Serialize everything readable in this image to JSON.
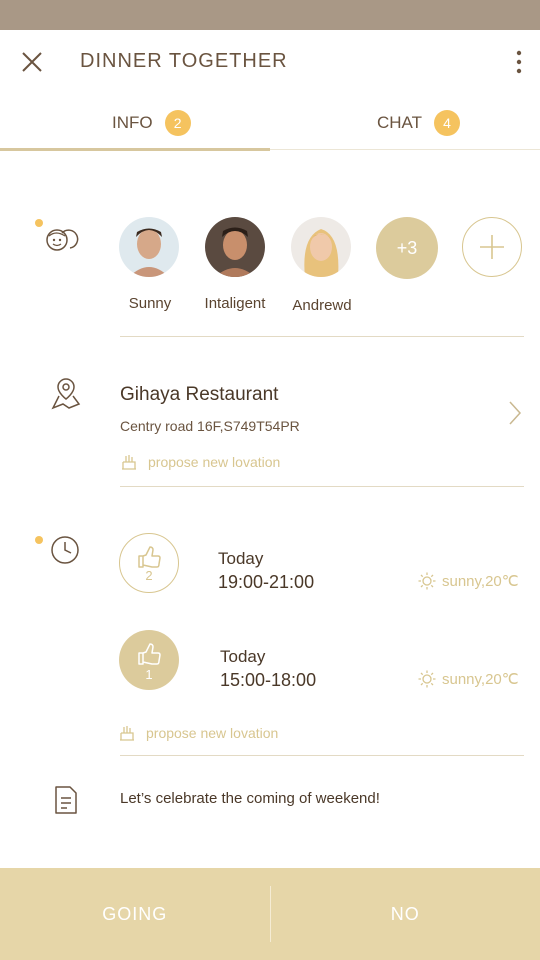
{
  "header": {
    "title": "DINNER TOGETHER"
  },
  "tabs": [
    {
      "label": "INFO",
      "badge": "2"
    },
    {
      "label": "CHAT",
      "badge": "4"
    }
  ],
  "participants": {
    "people": [
      {
        "name": "Sunny"
      },
      {
        "name": "Intaligent"
      },
      {
        "name": "Andrewd"
      }
    ],
    "more_count": "+3"
  },
  "location": {
    "name": "Gihaya Restaurant",
    "address": "Centry road 16F,S749T54PR",
    "propose_label": "propose new lovation"
  },
  "time_slots": [
    {
      "votes": "2",
      "day": "Today",
      "time": "19:00-21:00",
      "weather": "sunny,20℃",
      "voted": false
    },
    {
      "votes": "1",
      "day": "Today",
      "time": "15:00-18:00",
      "weather": "sunny,20℃",
      "voted": true
    }
  ],
  "time_propose_label": "propose new lovation",
  "note": "Let’s celebrate the coming of weekend!",
  "footer": {
    "going_label": "GOING",
    "no_label": "NO"
  },
  "colors": {
    "accent": "#f5c35f",
    "gold": "#dccb9c",
    "footer": "#e6d6a8",
    "statusbar": "#a99886"
  }
}
